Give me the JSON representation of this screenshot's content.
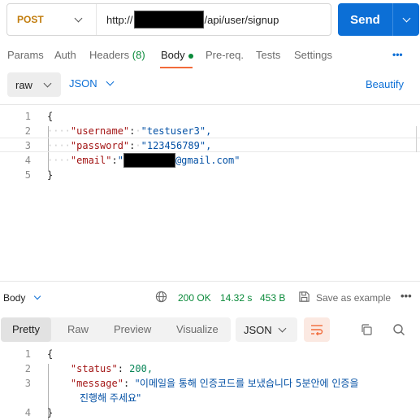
{
  "request": {
    "method": "POST",
    "url_prefix": "http://",
    "url_suffix": "/api/user/signup",
    "send_label": "Send"
  },
  "request_tabs": [
    {
      "label": "Params"
    },
    {
      "label": "Auth"
    },
    {
      "label": "Headers",
      "count": "(8)"
    },
    {
      "label": "Body",
      "active": true
    },
    {
      "label": "Pre-req."
    },
    {
      "label": "Tests"
    },
    {
      "label": "Settings"
    }
  ],
  "more_label": "•••",
  "body_options": {
    "mode": "raw",
    "format": "JSON",
    "beautify_label": "Beautify"
  },
  "request_body": {
    "line_numbers": [
      "1",
      "2",
      "3",
      "4",
      "5"
    ],
    "open_brace": "{",
    "close_brace": "}",
    "fields": [
      {
        "key": "\"username\"",
        "value": "\"testuser3\","
      },
      {
        "key": "\"password\"",
        "value": "\"123456789\","
      },
      {
        "key": "\"email\"",
        "value_suffix": "@gmail.com\""
      }
    ]
  },
  "response_bar": {
    "label": "Body",
    "status": "200 OK",
    "time": "14.32 s",
    "size": "453 B",
    "save_label": "Save as example",
    "more": "•••"
  },
  "response_views": [
    "Pretty",
    "Raw",
    "Preview",
    "Visualize"
  ],
  "response_format": "JSON",
  "response_body": {
    "line_numbers": [
      "1",
      "2",
      "3",
      "4"
    ],
    "open_brace": "{",
    "close_brace": "}",
    "status_key": "\"status\"",
    "status_value": "200,",
    "message_key": "\"message\"",
    "message_line1": "\"이메일을 통해 인증코드를 보냈습니다 5분안에 인증을",
    "message_line2": "진행해 주세요\""
  },
  "colors": {
    "accent": "#0c6fd6",
    "method": "#c27d0e",
    "success": "#0a8a3a",
    "active_tab_underline": "#f26b3a"
  }
}
